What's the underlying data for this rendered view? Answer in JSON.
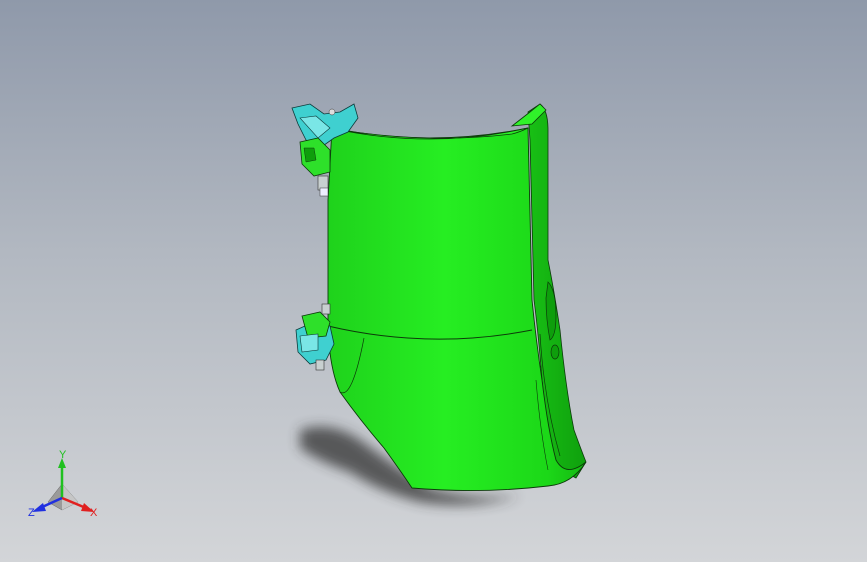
{
  "viewport": {
    "background_top": "#8f99aa",
    "background_bottom": "#d3d5d8"
  },
  "model": {
    "body_color": "#22e61e",
    "edge_color": "#0c3a0a",
    "clip_color": "#3fd0d0",
    "shadow_color": "#3a3a3a"
  },
  "triad": {
    "x_label": "X",
    "y_label": "Y",
    "z_label": "Z",
    "x_color": "#e02020",
    "y_color": "#20c020",
    "z_color": "#2030e0"
  }
}
